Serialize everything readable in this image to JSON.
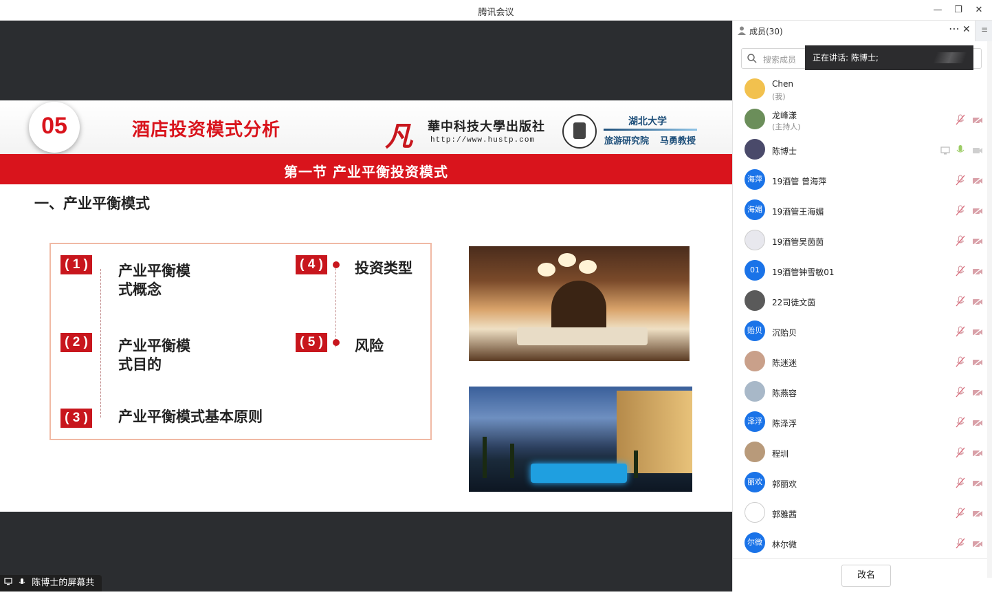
{
  "window": {
    "title": "腾讯会议"
  },
  "slide": {
    "number": "05",
    "title": "酒店投资模式分析",
    "publisher": {
      "logo": "凡",
      "name": "華中科技大學出版社",
      "url": "http://www.hustp.com"
    },
    "university": {
      "name": "湖北大学",
      "dept": "旅游研究院",
      "professor": "马勇教授"
    },
    "band": "第一节   产业平衡投资模式",
    "section_title": "一、产业平衡模式",
    "items": [
      {
        "badge": "( 1 )",
        "text_line1": "产业平衡模",
        "text_line2": "式概念"
      },
      {
        "badge": "( 2 )",
        "text_line1": "产业平衡模",
        "text_line2": "式目的"
      },
      {
        "badge": "( 3 )",
        "text": "产业平衡模式基本原则"
      },
      {
        "badge": "( 4 )",
        "text": "投资类型"
      },
      {
        "badge": "( 5 )",
        "text": "风险"
      }
    ]
  },
  "share_label": "陈博士的屏幕共享",
  "members_panel": {
    "title": "成员(30)",
    "search_placeholder": "搜索成员",
    "speaking": "正在讲话: 陈博士;",
    "rename_button": "改名",
    "members": [
      {
        "name": "Chen",
        "role": "(我)",
        "avatar_text": "",
        "avatar_color": "#f2c14e"
      },
      {
        "name": "龙峰漾",
        "role": "(主持人)",
        "avatar_text": "",
        "avatar_color": "#6b8e5a"
      },
      {
        "name": "陈博士",
        "role": "",
        "avatar_text": "",
        "avatar_color": "#4a4a6a"
      },
      {
        "name": "19酒管 曾海萍",
        "role": "",
        "avatar_text": "海萍",
        "avatar_color": "#1a73e8"
      },
      {
        "name": "19酒管王海媚",
        "role": "",
        "avatar_text": "海媚",
        "avatar_color": "#1a73e8"
      },
      {
        "name": "19酒管吴茵茵",
        "role": "",
        "avatar_text": "",
        "avatar_color": "#e8e8ee"
      },
      {
        "name": "19酒管钟雪敏01",
        "role": "",
        "avatar_text": "01",
        "avatar_color": "#1a73e8"
      },
      {
        "name": "22司徒文茵",
        "role": "",
        "avatar_text": "",
        "avatar_color": "#5a5a5a"
      },
      {
        "name": "沉贻贝",
        "role": "",
        "avatar_text": "贻贝",
        "avatar_color": "#1a73e8"
      },
      {
        "name": "陈迷迷",
        "role": "",
        "avatar_text": "",
        "avatar_color": "#c9a08a"
      },
      {
        "name": "陈燕容",
        "role": "",
        "avatar_text": "",
        "avatar_color": "#a8b8c8"
      },
      {
        "name": "陈泽浮",
        "role": "",
        "avatar_text": "泽浮",
        "avatar_color": "#1a73e8"
      },
      {
        "name": "程圳",
        "role": "",
        "avatar_text": "",
        "avatar_color": "#b89a7a"
      },
      {
        "name": "郭丽欢",
        "role": "",
        "avatar_text": "丽欢",
        "avatar_color": "#1a73e8"
      },
      {
        "name": "郭雅茜",
        "role": "",
        "avatar_text": "",
        "avatar_color": "#ffffff"
      },
      {
        "name": "林尔微",
        "role": "",
        "avatar_text": "尔微",
        "avatar_color": "#1a73e8"
      }
    ]
  }
}
